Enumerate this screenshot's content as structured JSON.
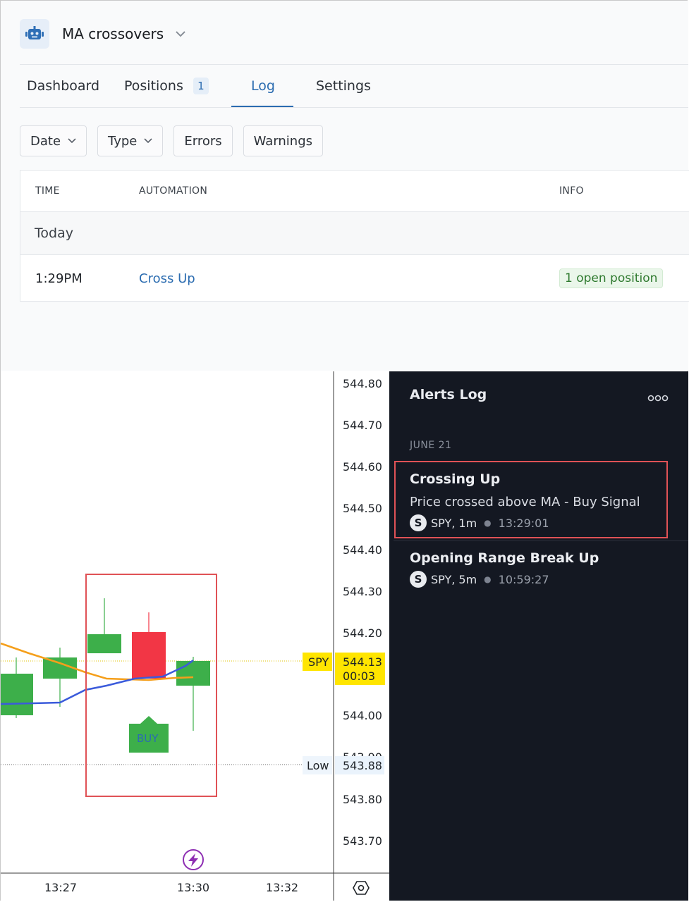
{
  "app": {
    "title": "MA crossovers",
    "icon": "robot-icon",
    "tabs": [
      {
        "label": "Dashboard",
        "badge": null,
        "active": false
      },
      {
        "label": "Positions",
        "badge": "1",
        "active": false
      },
      {
        "label": "Log",
        "badge": null,
        "active": true
      },
      {
        "label": "Settings",
        "badge": null,
        "active": false
      }
    ],
    "filters": [
      {
        "label": "Date",
        "dropdown": true
      },
      {
        "label": "Type",
        "dropdown": true
      },
      {
        "label": "Errors",
        "dropdown": false
      },
      {
        "label": "Warnings",
        "dropdown": false
      }
    ],
    "table": {
      "columns": [
        "TIME",
        "AUTOMATION",
        "INFO"
      ],
      "group": "Today",
      "rows": [
        {
          "time": "1:29PM",
          "automation": "Cross Up",
          "info": "1 open position"
        }
      ]
    },
    "colors": {
      "accent": "#2b6cb0",
      "success": "#2f7a2f"
    }
  },
  "chart": {
    "price_ticks": [
      "544.80",
      "544.70",
      "544.60",
      "544.50",
      "544.40",
      "544.30",
      "544.20",
      "544.00",
      "543.90",
      "543.80",
      "543.70"
    ],
    "time_ticks": [
      "13:27",
      "13:30",
      "13:32"
    ],
    "symbol_label": "SPY",
    "last_price": "544.13",
    "countdown": "00:03",
    "low_label": "Low",
    "low_price": "543.88",
    "buy_label": "BUY",
    "colors": {
      "up": "#3daf4a",
      "down": "#f23645",
      "ma_fast": "#3b5bdb",
      "ma_slow": "#f59f1b",
      "price_tag": "#ffe500"
    },
    "icons": [
      "lightning-icon",
      "settings-hexagon-icon"
    ]
  },
  "alerts": {
    "title": "Alerts Log",
    "date": "JUNE 21",
    "items": [
      {
        "name": "Crossing Up",
        "message": "Price crossed above MA - Buy Signal",
        "symbol_initial": "S",
        "symbol": "SPY, 1m",
        "time": "13:29:01"
      },
      {
        "name": "Opening Range Break Up",
        "message": "",
        "symbol_initial": "S",
        "symbol": "SPY, 5m",
        "time": "10:59:27"
      }
    ]
  }
}
